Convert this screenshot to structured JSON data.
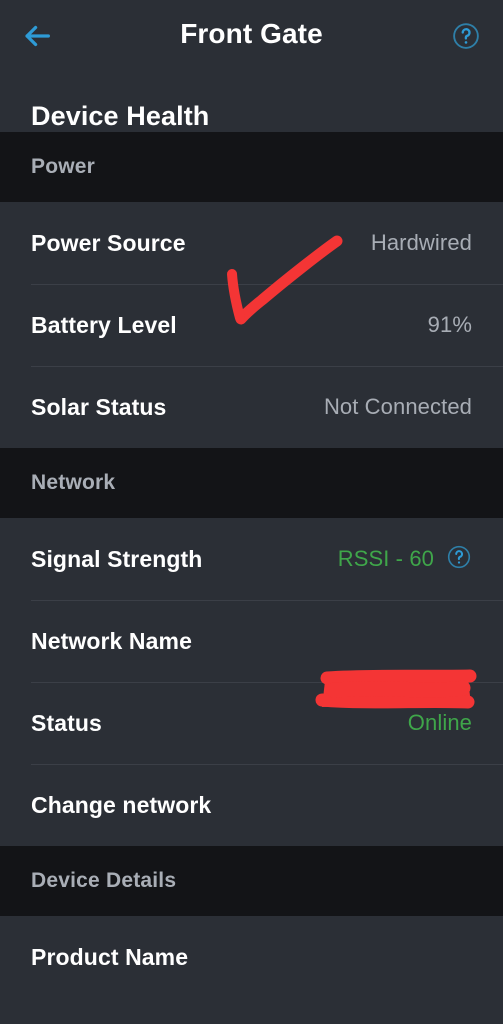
{
  "theme": {
    "page_bg": "#2b2f36",
    "section_band_bg": "#131417",
    "accent_blue": "#2e9bd6",
    "status_green": "#3fa64a",
    "value_gray": "#a8adb5",
    "annotation_red": "#f43535",
    "divider": "#3b3f47"
  },
  "topbar": {
    "back_icon": "arrow-left-icon",
    "title": "Front Gate",
    "help_icon": "help-circle-icon"
  },
  "page": {
    "title": "Device Health"
  },
  "sections": [
    {
      "id": "power",
      "header": "Power",
      "rows": [
        {
          "id": "power-source",
          "label": "Power Source",
          "value": "Hardwired",
          "value_color": "gray",
          "help": false,
          "redacted": false
        },
        {
          "id": "battery-level",
          "label": "Battery Level",
          "value": "91%",
          "value_color": "gray",
          "help": false,
          "redacted": false
        },
        {
          "id": "solar-status",
          "label": "Solar Status",
          "value": "Not Connected",
          "value_color": "gray",
          "help": false,
          "redacted": false
        }
      ]
    },
    {
      "id": "network",
      "header": "Network",
      "rows": [
        {
          "id": "signal-strength",
          "label": "Signal Strength",
          "value": "RSSI - 60",
          "value_color": "green",
          "help": true,
          "redacted": false
        },
        {
          "id": "network-name",
          "label": "Network Name",
          "value": "",
          "value_color": "gray",
          "help": false,
          "redacted": true
        },
        {
          "id": "status",
          "label": "Status",
          "value": "Online",
          "value_color": "green",
          "help": false,
          "redacted": false
        },
        {
          "id": "change-network",
          "label": "Change network",
          "value": "",
          "value_color": "gray",
          "help": false,
          "redacted": false
        }
      ]
    },
    {
      "id": "device-details",
      "header": "Device Details",
      "rows": [
        {
          "id": "product-name",
          "label": "Product Name",
          "value": "",
          "value_color": "gray",
          "help": false,
          "redacted": false
        }
      ]
    }
  ],
  "annotations": {
    "arrow": {
      "name": "red-arrow-annotation",
      "color": "#f43535",
      "target": "Power Source"
    },
    "redaction": {
      "name": "red-redaction-annotation",
      "color": "#f43535",
      "target": "Network Name value"
    }
  }
}
